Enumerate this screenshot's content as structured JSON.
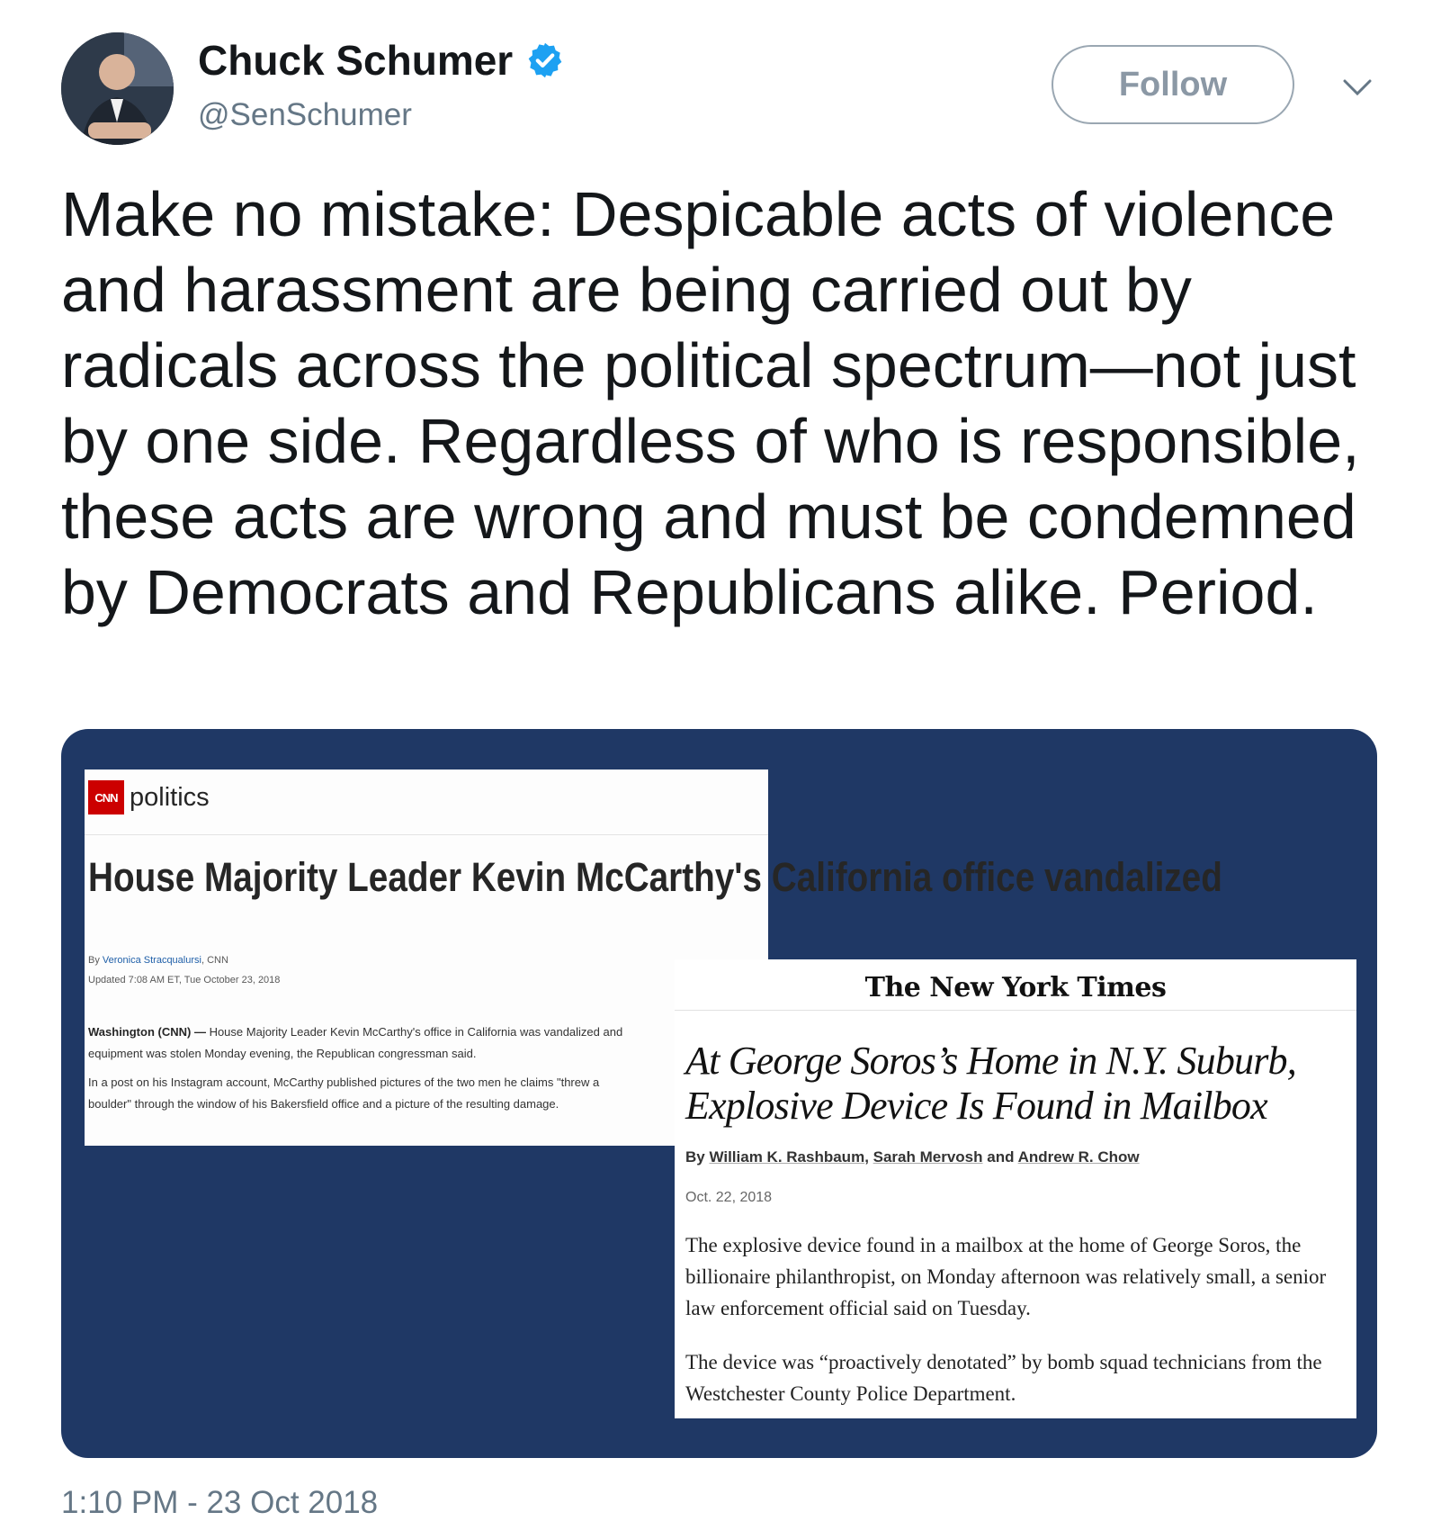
{
  "author": {
    "name": "Chuck Schumer",
    "handle": "@SenSchumer",
    "verified": true
  },
  "actions": {
    "follow_label": "Follow"
  },
  "tweet": {
    "text": "Make no mistake: Despicable acts of violence and harassment are being carried out by radicals across the political spectrum—not just by one side. Regardless of who is responsible, these acts are wrong and must be condemned by Democrats and Republicans alike. Period.",
    "timestamp": "1:10 PM - 23 Oct 2018"
  },
  "media": {
    "background_color": "#1f3865",
    "cnn": {
      "logo": "CNN",
      "section": "politics",
      "headline": "House Majority Leader Kevin McCarthy's California office vandalized",
      "byline_prefix": "By",
      "byline_author": "Veronica Stracqualursi",
      "byline_suffix": ", CNN",
      "updated": "Updated 7:08 AM ET, Tue October 23, 2018",
      "dateline": "Washington (CNN) —",
      "para1": " House Majority Leader Kevin McCarthy's office in California was vandalized and equipment was stolen Monday evening, the Republican congressman said.",
      "para2": "In a post on his Instagram account, McCarthy published pictures of the two men he claims \"threw a boulder\" through the window of his Bakersfield office and a picture of the resulting damage."
    },
    "nyt": {
      "logo": "The New York Times",
      "headline": "At George Soros’s Home in N.Y. Suburb, Explosive Device Is Found in Mailbox",
      "byline_prefix": "By",
      "author1": "William K. Rashbaum",
      "author2": "Sarah Mervosh",
      "author3": "Andrew R. Chow",
      "date": "Oct. 22, 2018",
      "para1": "The explosive device found in a mailbox at the home of George Soros, the billionaire philanthropist, on Monday afternoon was relatively small, a senior law enforcement official said on Tuesday.",
      "para2": "The device was “proactively denotated” by bomb squad technicians from the Westchester County Police Department."
    }
  },
  "colors": {
    "verified_badge": "#1da1f2",
    "cnn_red": "#cc0000",
    "secondary_text": "#657786"
  }
}
